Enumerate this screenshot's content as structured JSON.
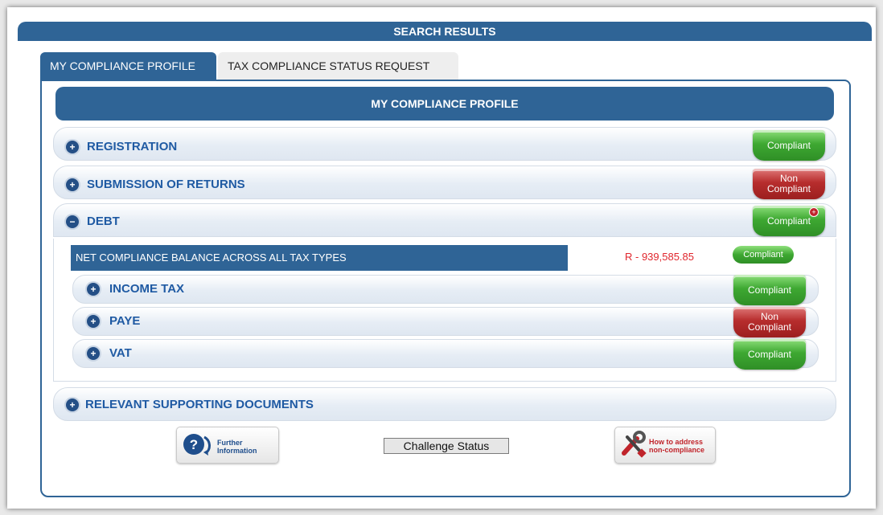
{
  "header": {
    "title": "SEARCH RESULTS"
  },
  "tabs": [
    {
      "label": "MY COMPLIANCE PROFILE",
      "active": true
    },
    {
      "label": "TAX COMPLIANCE STATUS REQUEST",
      "active": false
    }
  ],
  "profile": {
    "title": "MY COMPLIANCE PROFILE",
    "sections": [
      {
        "label": "REGISTRATION",
        "toggle": "+",
        "status": "Compliant"
      },
      {
        "label": "SUBMISSION OF RETURNS",
        "toggle": "+",
        "status": "Non\nCompliant"
      },
      {
        "label": "DEBT",
        "toggle": "−",
        "status": "Compliant"
      },
      {
        "label": "RELEVANT SUPPORTING DOCUMENTS",
        "toggle": "+"
      }
    ],
    "debt": {
      "net_label": "NET COMPLIANCE BALANCE ACROSS ALL TAX TYPES",
      "net_amount": "R - 939,585.85",
      "net_status": "Compliant",
      "items": [
        {
          "label": "INCOME TAX",
          "status": "Compliant"
        },
        {
          "label": "PAYE",
          "status": "Non\nCompliant"
        },
        {
          "label": "VAT",
          "status": "Compliant"
        }
      ]
    }
  },
  "footer": {
    "further_info": "Further\nInformation",
    "challenge": "Challenge Status",
    "how_to": "How to address\nnon-compliance"
  },
  "colors": {
    "primary": "#2f6496",
    "compliant": "#3ea832",
    "non_compliant": "#b72d2d",
    "amount": "#e0262d"
  }
}
